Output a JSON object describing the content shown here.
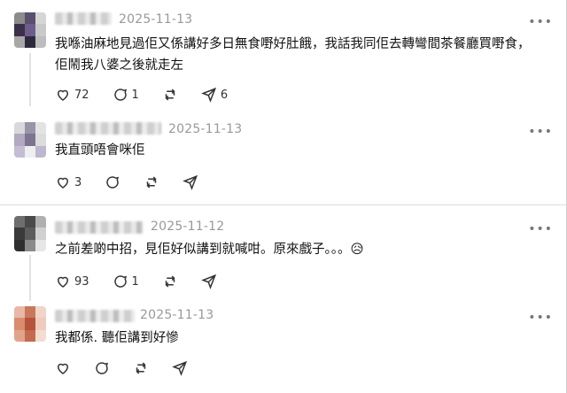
{
  "posts": [
    {
      "date": "2025-11-13",
      "text": "我喺油麻地見過佢又係講好多日無食嘢好肚餓，我話我同佢去轉彎間茶餐廳買嘢食，佢鬧我八婆之後就走左",
      "likes": "72",
      "replies": "1",
      "reposts": "",
      "shares": "6",
      "avatar_colors": [
        "#8c8c8c",
        "#5a4f6e",
        "#d6d6d6",
        "#3b2f4a",
        "#6e5c8a",
        "#c9c9c9",
        "#a8a8a8",
        "#2e2a3c",
        "#bdbdbd"
      ]
    },
    {
      "date": "2025-11-13",
      "text": "我直頭唔會咪佢",
      "likes": "3",
      "replies": "",
      "reposts": "",
      "shares": "",
      "avatar_colors": [
        "#d9d9d9",
        "#9b93a8",
        "#e3e3e3",
        "#b3a9c2",
        "#7d7490",
        "#dcdcdc",
        "#c5bdd6",
        "#efefef",
        "#bfb6cf"
      ]
    },
    {
      "date": "2025-11-12",
      "text": "之前差啲中招，見佢好似講到就喊咁。原來戲子。。。😥",
      "likes": "93",
      "replies": "1",
      "reposts": "",
      "shares": "",
      "avatar_colors": [
        "#6e6e6e",
        "#4a4a4a",
        "#b0b0b0",
        "#3a3a3a",
        "#5c5c5c",
        "#d0d0d0",
        "#2f2f2f",
        "#8a8a8a",
        "#e6e6e6"
      ]
    },
    {
      "date": "2025-11-13",
      "text": "我都係. 聽佢講到好慘",
      "likes": "",
      "replies": "",
      "reposts": "",
      "shares": "",
      "avatar_colors": [
        "#e8b8a8",
        "#c9785e",
        "#f0d5c8",
        "#d98c6e",
        "#b5543a",
        "#efcbbd",
        "#e0a48c",
        "#c46a4e",
        "#f3ddd2"
      ]
    }
  ],
  "more_icon": "more-horizontal-icon",
  "icons": [
    "heart-icon",
    "reply-icon",
    "repost-icon",
    "share-icon"
  ]
}
